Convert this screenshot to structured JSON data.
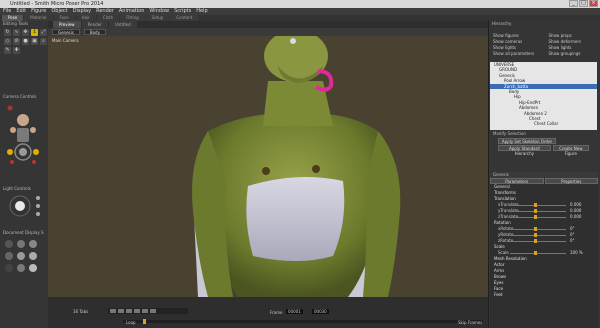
{
  "window": {
    "title": "Untitled - Smith Micro Poser Pro 2014"
  },
  "menu": [
    "File",
    "Edit",
    "Figure",
    "Object",
    "Display",
    "Render",
    "Animation",
    "Window",
    "Scripts",
    "Help"
  ],
  "rooms": [
    "Pose",
    "Material",
    "Face",
    "Hair",
    "Cloth",
    "Fitting",
    "Setup",
    "Content"
  ],
  "left": {
    "editing_tools": "Editing Tools",
    "camera_controls": "Camera Controls",
    "light_controls": "Light Controls",
    "document_display": "Document Display S"
  },
  "viewport": {
    "tabs": [
      "Preview",
      "Render",
      "Untitled"
    ],
    "camera_dd": "Genesis",
    "part_dd": "Body",
    "camera_label": "Main Camera"
  },
  "timeline": {
    "frame_label": "Frame",
    "frame_value": "00001",
    "of": "00030",
    "loop_label": "Loop",
    "skip_label": "Skip Frames",
    "tabs_label": "16 Tabs"
  },
  "hierarchy": {
    "title": "Hierarchy",
    "checks": [
      [
        "Show figures",
        "Show props"
      ],
      [
        "Show cameras",
        "Show deformers"
      ],
      [
        "Show lights",
        "Show lights"
      ],
      [
        "Show all parameters",
        "Show groupings"
      ]
    ],
    "tree": [
      "UNIVERSE",
      "GROUND",
      "Genesis",
      "Pool Arrow",
      "Zorch_batta",
      "Body",
      "Hip",
      "Hip-EndPrt",
      "Abdomen",
      "Abdomen 2",
      "Chest",
      "Chest Collar"
    ],
    "selected_index": 4,
    "modify_label": "Modify Selection",
    "buttons": [
      "Apply Set Skeleton Order",
      "Apply Standard Hierarchy",
      "Create New Figure"
    ]
  },
  "params": {
    "section": "Genesis",
    "tabs": [
      "Parameters",
      "Properties"
    ],
    "groups": [
      {
        "name": "General"
      },
      {
        "name": "Transforms"
      },
      {
        "name": "Translation"
      },
      {
        "name": "xTranslate",
        "value": "0.000"
      },
      {
        "name": "yTranslate",
        "value": "0.000"
      },
      {
        "name": "zTranslate",
        "value": "0.000"
      },
      {
        "name": "Rotation"
      },
      {
        "name": "xRotate",
        "value": "0°"
      },
      {
        "name": "yRotate",
        "value": "0°"
      },
      {
        "name": "zRotate",
        "value": "0°"
      },
      {
        "name": "Scale"
      },
      {
        "name": "Scale",
        "value": "100 %"
      },
      {
        "name": "Mesh Resolution"
      },
      {
        "name": "Actor"
      },
      {
        "name": "Arms"
      },
      {
        "name": "Brows"
      },
      {
        "name": "Eyes"
      },
      {
        "name": "Face"
      },
      {
        "name": "Feet"
      }
    ]
  },
  "colors": {
    "accent": "#d9b400",
    "select": "#3b6db3",
    "viewport_bg": "#4a4230"
  }
}
